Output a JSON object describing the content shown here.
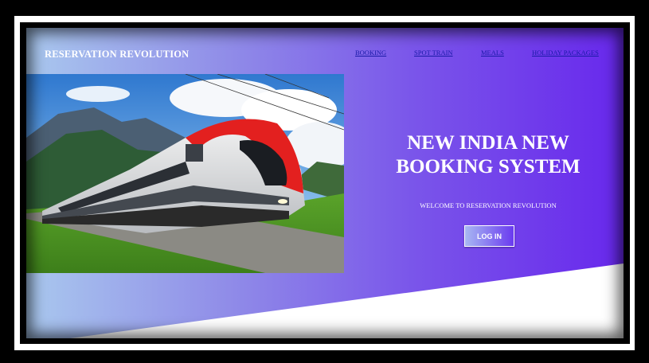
{
  "header": {
    "brand": "RESERVATION REVOLUTION",
    "nav": [
      {
        "label": "BOOKING"
      },
      {
        "label": "SPOT TRAIN"
      },
      {
        "label": "MEALS"
      },
      {
        "label": "HOLIDAY PACKAGES"
      }
    ]
  },
  "hero": {
    "headline_line1": "NEW INDIA NEW",
    "headline_line2": "BOOKING SYSTEM",
    "welcome": "WELCOME TO RESERVATION REVOLUTION",
    "login_label": "LOG IN",
    "image": "train-photo"
  },
  "colors": {
    "gradient_start": "#a9c8ee",
    "gradient_end": "#6828ec",
    "nav_link": "#1a1aa8",
    "text": "#ffffff"
  }
}
